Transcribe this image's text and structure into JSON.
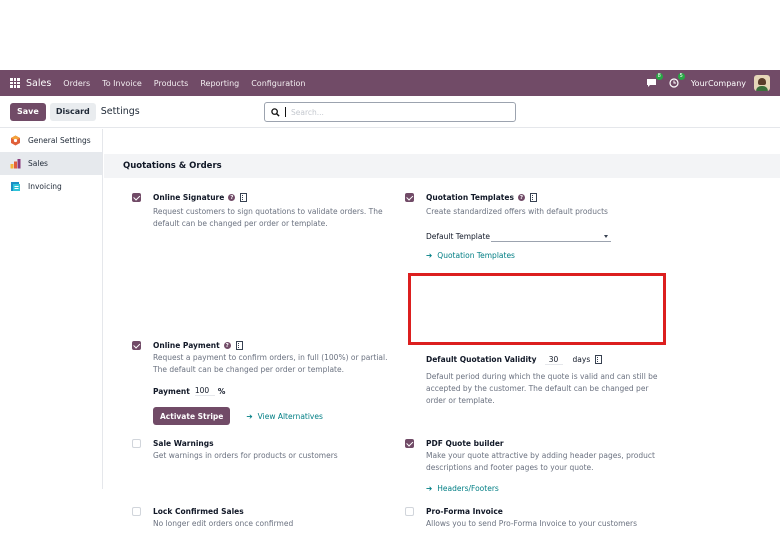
{
  "navbar": {
    "brand": "Sales",
    "menu": [
      "Orders",
      "To Invoice",
      "Products",
      "Reporting",
      "Configuration"
    ],
    "chat_badge": "8",
    "activity_badge": "5",
    "company": "YourCompany"
  },
  "control_panel": {
    "save_label": "Save",
    "discard_label": "Discard",
    "title": "Settings",
    "search_placeholder": "Search..."
  },
  "sidebar": {
    "items": [
      {
        "label": "General Settings",
        "icon": "general-settings-icon"
      },
      {
        "label": "Sales",
        "icon": "sales-app-icon",
        "active": true
      },
      {
        "label": "Invoicing",
        "icon": "invoicing-app-icon"
      }
    ]
  },
  "section": {
    "title": "Quotations & Orders"
  },
  "settings": {
    "online_signature": {
      "title": "Online Signature",
      "desc": [
        "Request customers to sign quotations to validate orders. The",
        "default can be changed per order or template."
      ],
      "checked": true
    },
    "quotation_templates": {
      "title": "Quotation Templates",
      "desc": [
        "Create standardized offers with default products"
      ],
      "field_label": "Default Template",
      "link": "Quotation Templates",
      "checked": true
    },
    "online_payment": {
      "title": "Online Payment",
      "desc": [
        "Request a payment to confirm orders, in full (100%) or partial.",
        "The default can be changed per order or template."
      ],
      "payment_label": "Payment",
      "payment_value": "100",
      "payment_unit": "%",
      "stripe_button": "Activate Stripe",
      "alternatives_link": "View Alternatives",
      "checked": true
    },
    "default_validity": {
      "title": "Default Quotation Validity",
      "value": "30",
      "unit": "days",
      "desc": [
        "Default period during which the quote is valid and can still be",
        "accepted by the customer. The default can be changed per",
        "order or template."
      ]
    },
    "sale_warnings": {
      "title": "Sale Warnings",
      "desc": [
        "Get warnings in orders for products or customers"
      ],
      "checked": false
    },
    "pdf_quote_builder": {
      "title": "PDF Quote builder",
      "desc": [
        "Make your quote attractive by adding header pages, product",
        "descriptions and footer pages to your quote."
      ],
      "link": "Headers/Footers",
      "checked": true
    },
    "lock_confirmed_sales": {
      "title": "Lock Confirmed Sales",
      "desc": [
        "No longer edit orders once confirmed"
      ],
      "checked": false
    },
    "pro_forma_invoice": {
      "title": "Pro-Forma Invoice",
      "desc": [
        "Allows you to send Pro-Forma Invoice to your customers"
      ],
      "checked": false
    }
  },
  "colors": {
    "brand": "#714b67",
    "link": "#017e84",
    "highlight": "#dc1f1f"
  }
}
